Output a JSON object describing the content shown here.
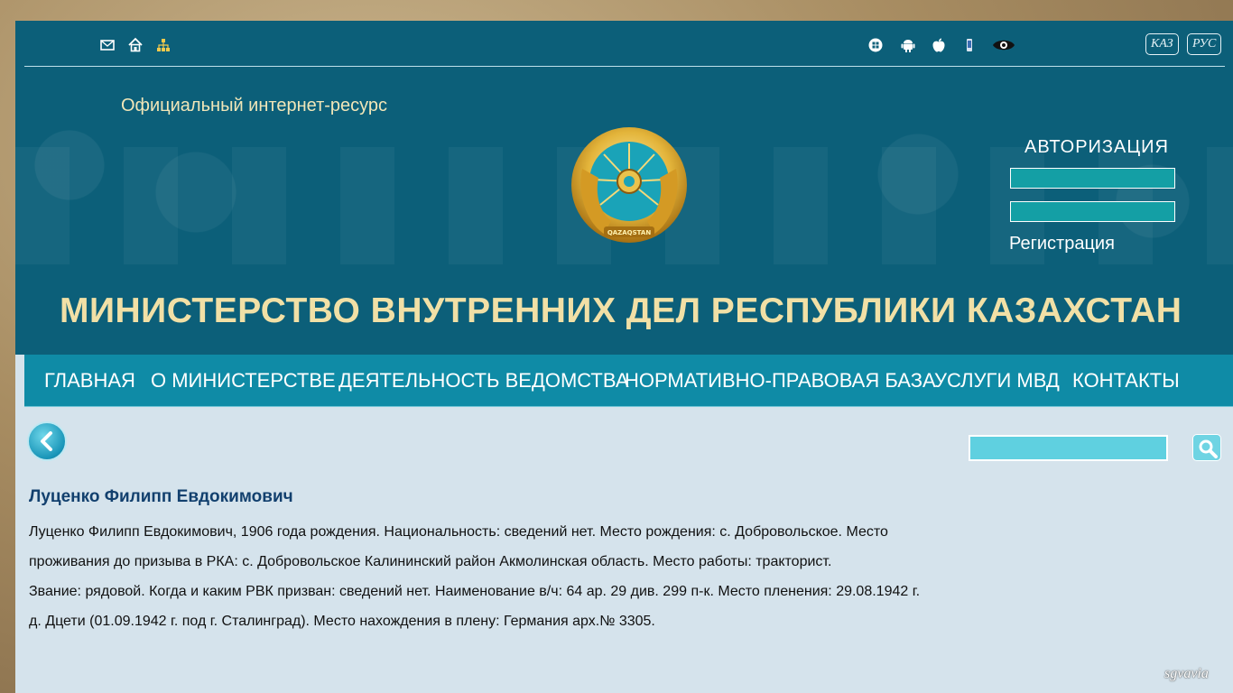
{
  "topbar": {
    "icons_left": [
      "mail-icon",
      "home-icon",
      "sitemap-icon"
    ],
    "icons_right": [
      "windows-icon",
      "android-icon",
      "apple-icon",
      "mobile-icon",
      "eye-icon"
    ],
    "lang_kz": "КАЗ",
    "lang_ru": "РУС"
  },
  "header": {
    "official_label": "Официальный интернет-ресурс",
    "emblem_label": "QAZAQSTAN",
    "title": "МИНИСТЕРСТВО ВНУТРЕННИХ ДЕЛ РЕСПУБЛИКИ КАЗАХСТАН"
  },
  "auth": {
    "title": "АВТОРИЗАЦИЯ",
    "login_value": "",
    "password_value": "",
    "register_label": "Регистрация"
  },
  "nav": {
    "items": [
      {
        "label": "ГЛАВНАЯ"
      },
      {
        "label": "О МИНИСТЕРСТВЕ"
      },
      {
        "label": "ДЕЯТЕЛЬНОСТЬ ВЕДОМСТВА"
      },
      {
        "label": "НОРМАТИВНО-ПРАВОВАЯ БАЗА"
      },
      {
        "label": "УСЛУГИ МВД"
      },
      {
        "label": "КОНТАКТЫ"
      }
    ]
  },
  "search": {
    "value": ""
  },
  "content": {
    "person_name": "Луценко Филипп Евдокимович",
    "bio_lines": [
      "Луценко Филипп Евдокимович, 1906 года рождения. Национальность: сведений нет. Место рождения: с. Добровольское. Место",
      "проживания до призыва в РКА: с. Добровольское Калининский район Акмолинская область. Место работы: тракторист.",
      "Звание: рядовой. Когда и каким РВК призван: сведений нет. Наименование в/ч: 64 ар. 29 див. 299 п-к. Место пленения: 29.08.1942 г.",
      "д. Дцети (01.09.1942 г. под г. Сталинград). Место нахождения в плену: Германия арх.№ 3305."
    ]
  },
  "watermark": "sgvavia",
  "colors": {
    "header_bg": "#0c5f79",
    "nav_bg": "#0f8ba6",
    "content_bg": "#d5e3ec",
    "title_gold": "#f1e0a6",
    "name_blue": "#12406e"
  }
}
